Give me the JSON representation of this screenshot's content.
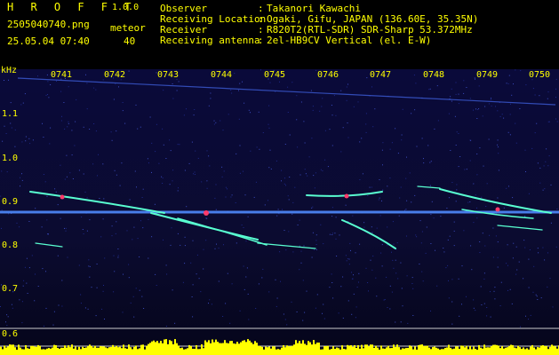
{
  "app": {
    "name": "H R O F F T",
    "version": "1.0.0"
  },
  "file": {
    "name": "2505040740.png",
    "datetime": "25.05.04 07:40"
  },
  "meteor": {
    "label": "meteor",
    "count": "40"
  },
  "info": [
    {
      "key": "Observer",
      "value": "Takanori Kawachi"
    },
    {
      "key": "Receiving Location",
      "value": "Ogaki, Gifu, JAPAN (136.60E, 35.35N)"
    },
    {
      "key": "Receiver",
      "value": "R820T2(RTL-SDR) SDR-Sharp 53.372MHz"
    },
    {
      "key": "Receiving antenna",
      "value": "2el-HB9CV Vertical (el. E-W)"
    }
  ],
  "axis": {
    "unit": "kHz",
    "freq_labels": [
      "1.1",
      "1.0",
      "0.9",
      "0.8",
      "0.7",
      "0.6"
    ],
    "time_labels": [
      "0741",
      "0742",
      "0743",
      "0744",
      "0745",
      "0746",
      "0747",
      "0748",
      "0749",
      "0750"
    ]
  },
  "colors": {
    "text": "#ffff00",
    "background": "#000000",
    "spectrogram": "#0a0a3a",
    "carrier": "#4f8bff",
    "meteor": "#59ffd1",
    "bar": "#ffff00"
  }
}
